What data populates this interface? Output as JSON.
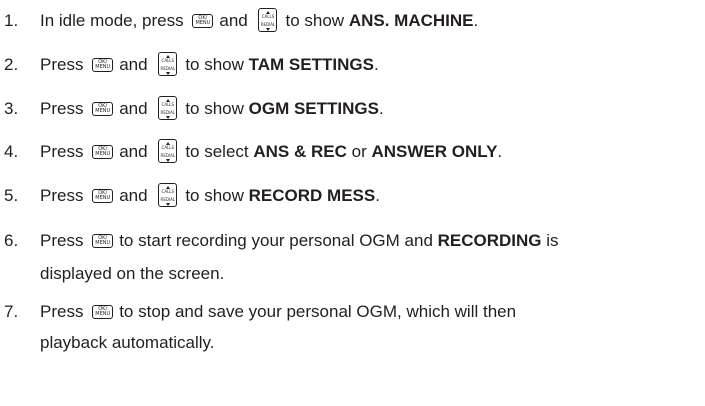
{
  "keys": {
    "ok_menu": {
      "line1": "OK/",
      "line2": "MENU"
    },
    "calls_redial": {
      "top": "CALLS",
      "bottom": "REDIAL"
    }
  },
  "steps": [
    {
      "num": "1.",
      "pre": "In idle mode, press",
      "and": "and",
      "post": "to show",
      "bold": "ANS. MACHINE",
      "end": "."
    },
    {
      "num": "2.",
      "pre": "Press",
      "and": "and",
      "post": "to show",
      "bold": "TAM SETTINGS",
      "end": "."
    },
    {
      "num": "3.",
      "pre": "Press",
      "and": "and",
      "post": "to show",
      "bold": "OGM SETTINGS",
      "end": "."
    },
    {
      "num": "4.",
      "pre": "Press",
      "and": "and",
      "post": "to select",
      "bold": "ANS & REC",
      "mid": "or",
      "bold2": "ANSWER ONLY",
      "end": "."
    },
    {
      "num": "5.",
      "pre": "Press",
      "and": "and",
      "post": "to show",
      "bold": "RECORD MESS",
      "end": "."
    },
    {
      "num": "6.",
      "pre": "Press",
      "post": "to start recording your personal OGM and",
      "bold": "RECORDING",
      "tail": "is",
      "line2": "displayed on the screen."
    },
    {
      "num": "7.",
      "pre": "Press",
      "post": "to stop and save your personal OGM, which will then",
      "line2": "playback automatically."
    }
  ]
}
